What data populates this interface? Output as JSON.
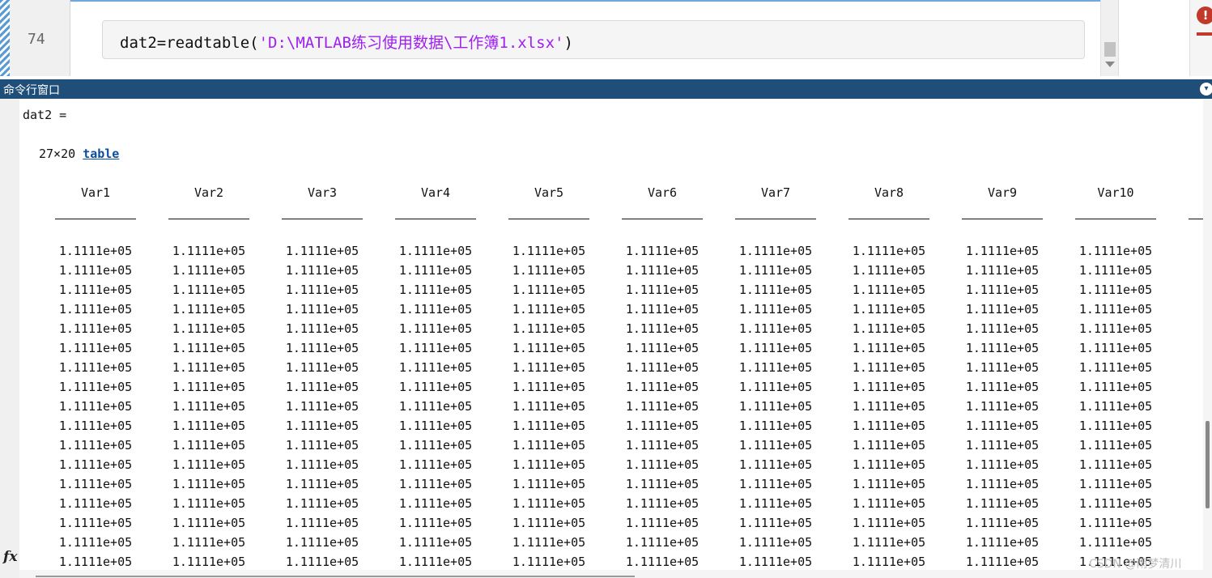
{
  "editor": {
    "line_number": "74",
    "code_prefix": "dat2=readtable(",
    "code_string": "'D:\\MATLAB练习使用数据\\工作簿1.xlsx'",
    "code_suffix": ")",
    "error_glyph": "!"
  },
  "command_window": {
    "title": "命令行窗口",
    "menu_glyph": "▾",
    "var_echo": "dat2 =",
    "size_text": "27×20 ",
    "class_link": "table",
    "fx_glyph": "fx",
    "columns": [
      "Var1",
      "Var2",
      "Var3",
      "Var4",
      "Var5",
      "Var6",
      "Var7",
      "Var8",
      "Var9",
      "Var10"
    ],
    "partial_column_value": "1.",
    "cell_value": "1.1111e+05",
    "row_count_visible": 17
  },
  "watermark": "CSDN @雨梦清川"
}
